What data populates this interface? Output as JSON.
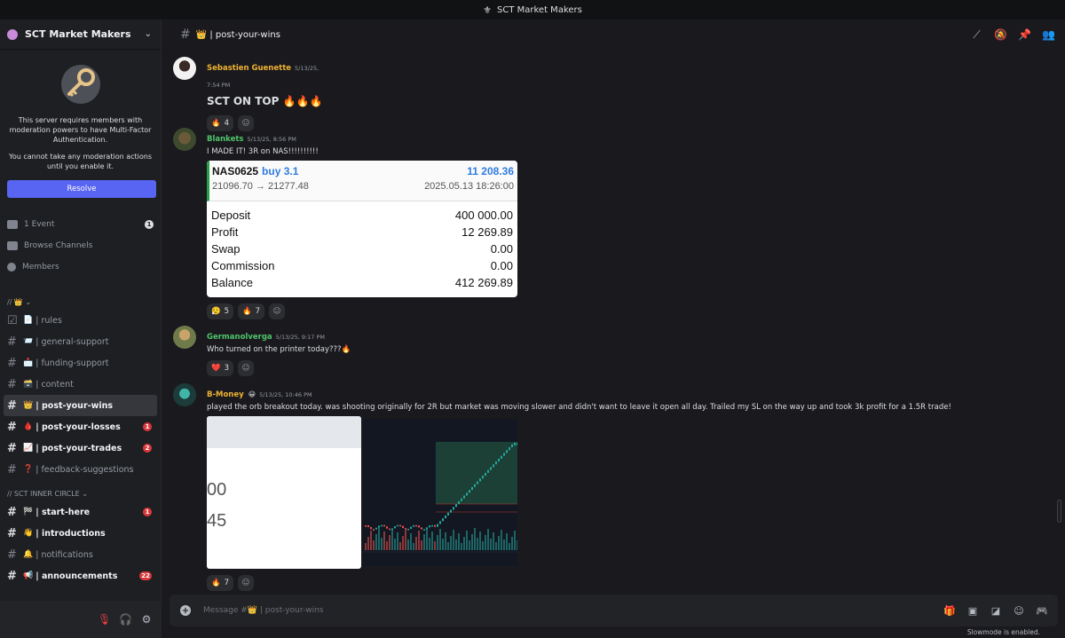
{
  "window": {
    "title": "SCT Market Makers"
  },
  "server": {
    "name": "SCT Market Makers"
  },
  "mfa": {
    "line1": "This server requires members with moderation powers to have Multi-Factor Authentication.",
    "line2": "You cannot take any moderation actions until you enable it.",
    "resolve_label": "Resolve"
  },
  "nav": {
    "events_label": "1 Event",
    "events_count": "1",
    "browse_label": "Browse Channels",
    "members_label": "Members"
  },
  "categories": {
    "first": "// 👑 ⌄",
    "inner": "// SCT INNER CIRCLE ⌄"
  },
  "channels": [
    {
      "emoji": "📄",
      "name": "| rules",
      "count": ""
    },
    {
      "emoji": "📨",
      "name": "| general-support",
      "count": ""
    },
    {
      "emoji": "📩",
      "name": "| funding-support",
      "count": ""
    },
    {
      "emoji": "🗃️",
      "name": "| content",
      "count": ""
    },
    {
      "emoji": "👑",
      "name": "| post-your-wins",
      "count": ""
    },
    {
      "emoji": "🩸",
      "name": "| post-your-losses",
      "count": "1"
    },
    {
      "emoji": "📈",
      "name": "| post-your-trades",
      "count": "2"
    },
    {
      "emoji": "❓",
      "name": "| feedback-suggestions",
      "count": ""
    },
    {
      "emoji": "🏁",
      "name": "| start-here",
      "count": "1"
    },
    {
      "emoji": "👋",
      "name": "| introductions",
      "count": ""
    },
    {
      "emoji": "🔔",
      "name": "| notifications",
      "count": ""
    },
    {
      "emoji": "📢",
      "name": "| announcements",
      "count": "22"
    }
  ],
  "channel_header": {
    "name": "👑 | post-your-wins"
  },
  "messages": [
    {
      "user": "Sebastien Guenette",
      "user_color": "#f0b232",
      "time": "5/13/25, 7:54 PM",
      "text": "SCT ON TOP 🔥🔥🔥",
      "reactions": [
        {
          "emoji": "🔥",
          "count": "4"
        }
      ]
    },
    {
      "user": "Blankets",
      "user_color": "#4fc46b",
      "time": "5/13/25, 8:56 PM",
      "text": "I MADE IT! 3R on NAS!!!!!!!!!!",
      "reactions": [
        {
          "emoji": "😮‍💨",
          "count": "5"
        },
        {
          "emoji": "🔥",
          "count": "7"
        }
      ]
    },
    {
      "user": "Germanolverga",
      "user_color": "#4fc46b",
      "time": "5/13/25, 9:17 PM",
      "text": "Who turned on the printer today???🔥",
      "reactions": [
        {
          "emoji": "❤️",
          "count": "3"
        }
      ]
    },
    {
      "user": "B-Money",
      "user_color": "#f0b232",
      "user_badge": "😀",
      "time": "5/13/25, 10:46 PM",
      "text": "played the orb breakout today. was shooting originally for 2R but market was moving slower and didn't want to leave it open all day. Trailed my SL on the way up and took 3k profit for a 1.5R trade!",
      "reactions": [
        {
          "emoji": "🔥",
          "count": "7"
        }
      ]
    }
  ],
  "trade_card": {
    "symbol": "NAS0625",
    "side": "buy 3.1",
    "profit": "11 208.36",
    "prices": "21096.70 → 21277.48",
    "datetime": "2025.05.13 18:26:00",
    "rows": [
      {
        "label": "Deposit",
        "value": "400 000.00"
      },
      {
        "label": "Profit",
        "value": "12 269.89"
      },
      {
        "label": "Swap",
        "value": "0.00"
      },
      {
        "label": "Commission",
        "value": "0.00"
      },
      {
        "label": "Balance",
        "value": "412 269.89"
      }
    ]
  },
  "screenshot_image": {
    "num1": "00",
    "num2": "45"
  },
  "composer": {
    "placeholder": "Message #👑 | post-your-wins",
    "slowmode": "Slowmode is enabled."
  }
}
